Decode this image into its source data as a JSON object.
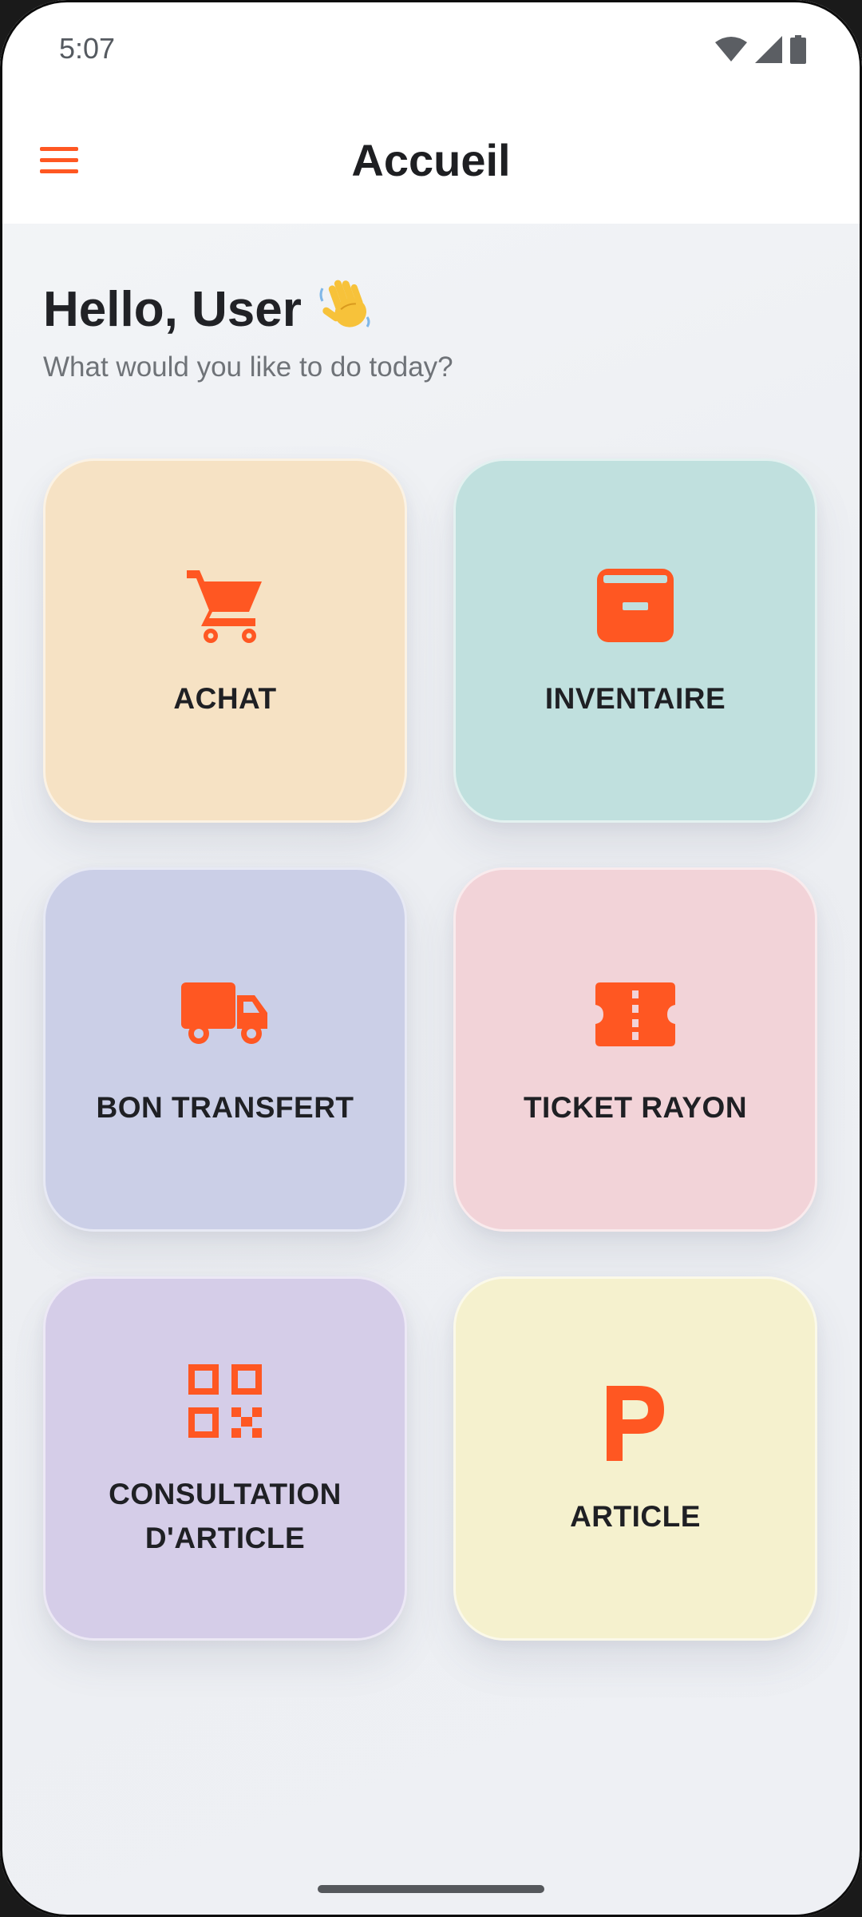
{
  "status_bar": {
    "time": "5:07",
    "icons": [
      "wifi-icon",
      "cellular-signal-icon",
      "battery-icon"
    ]
  },
  "app_bar": {
    "title": "Accueil",
    "menu_icon": "hamburger-menu-icon"
  },
  "header": {
    "greeting": "Hello, User",
    "greeting_emoji": "👋",
    "subtitle": "What would you like to do today?"
  },
  "colors": {
    "accent": "#FF5722",
    "tile_achat": "#F6E2C4",
    "tile_inventaire": "#C0E0DE",
    "tile_bon_transfert": "#CBCFE7",
    "tile_ticket_rayon": "#F2D3D8",
    "tile_consultation": "#D5CDE8",
    "tile_article": "#F5F1CE"
  },
  "tiles": [
    {
      "label": "ACHAT",
      "icon": "shopping-cart-icon"
    },
    {
      "label": "INVENTAIRE",
      "icon": "archive-box-icon"
    },
    {
      "label": "BON TRANSFERT",
      "icon": "delivery-truck-icon"
    },
    {
      "label": "TICKET RAYON",
      "icon": "ticket-icon"
    },
    {
      "label_line1": "CONSULTATION",
      "label_line2": "D'ARTICLE",
      "icon": "qr-code-icon"
    },
    {
      "label": "ARTICLE",
      "icon": "letter-p-icon"
    }
  ]
}
